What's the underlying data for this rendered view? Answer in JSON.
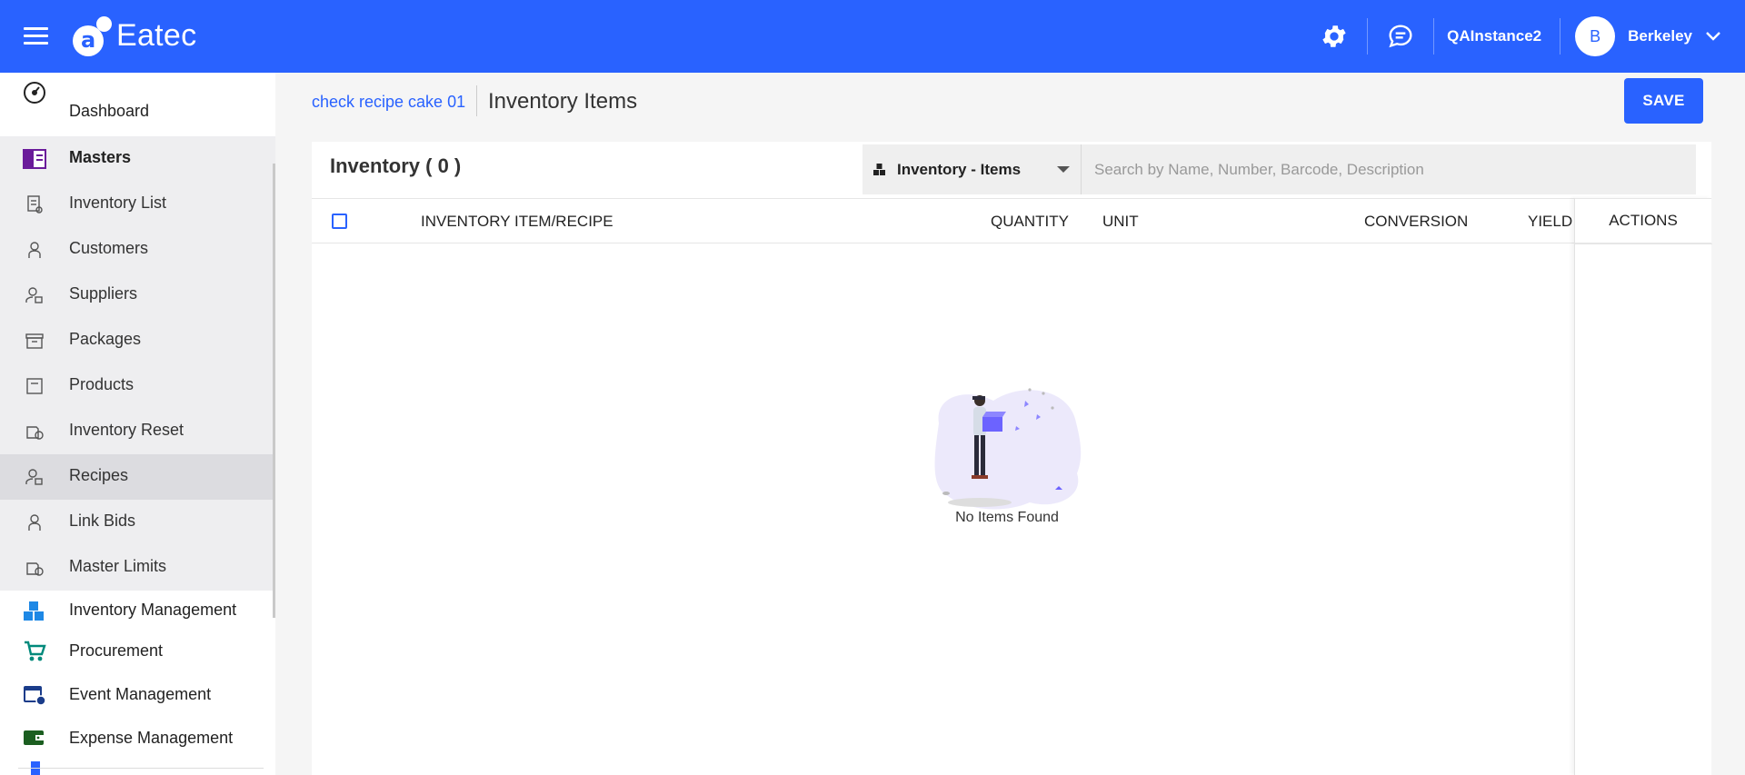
{
  "app": {
    "name": "Eatec",
    "instance": "QAInstance2",
    "user_initial": "B",
    "user_name": "Berkeley"
  },
  "sidebar": {
    "items": [
      {
        "label": "Dashboard",
        "icon": "dashboard-icon"
      },
      {
        "label": "Masters",
        "icon": "masters-icon"
      },
      {
        "label": "Inventory List",
        "icon": "inventory-list-icon"
      },
      {
        "label": "Customers",
        "icon": "customers-icon"
      },
      {
        "label": "Suppliers",
        "icon": "suppliers-icon"
      },
      {
        "label": "Packages",
        "icon": "packages-icon"
      },
      {
        "label": "Products",
        "icon": "products-icon"
      },
      {
        "label": "Inventory Reset",
        "icon": "inventory-reset-icon"
      },
      {
        "label": "Recipes",
        "icon": "recipes-icon"
      },
      {
        "label": "Link Bids",
        "icon": "link-bids-icon"
      },
      {
        "label": "Master Limits",
        "icon": "master-limits-icon"
      },
      {
        "label": "Inventory Management",
        "icon": "inventory-management-icon"
      },
      {
        "label": "Procurement",
        "icon": "procurement-icon"
      },
      {
        "label": "Event Management",
        "icon": "event-management-icon"
      },
      {
        "label": "Expense Management",
        "icon": "expense-management-icon"
      }
    ]
  },
  "header": {
    "breadcrumb": "check recipe cake 01",
    "title": "Inventory Items",
    "save_label": "SAVE"
  },
  "card": {
    "title": "Inventory ( 0 )",
    "filter_label": "Inventory - Items",
    "search_placeholder": "Search by Name, Number, Barcode, Description",
    "search_value": "",
    "columns": {
      "item": "INVENTORY ITEM/RECIPE",
      "quantity": "QUANTITY",
      "unit": "UNIT",
      "conversion": "CONVERSION",
      "yield": "YIELD",
      "actions": "ACTIONS"
    },
    "empty_text": "No Items Found"
  },
  "colors": {
    "primary": "#2962ff",
    "sidebar_sub_bg": "#eeeef0",
    "sidebar_active_bg": "#dcdce0"
  }
}
